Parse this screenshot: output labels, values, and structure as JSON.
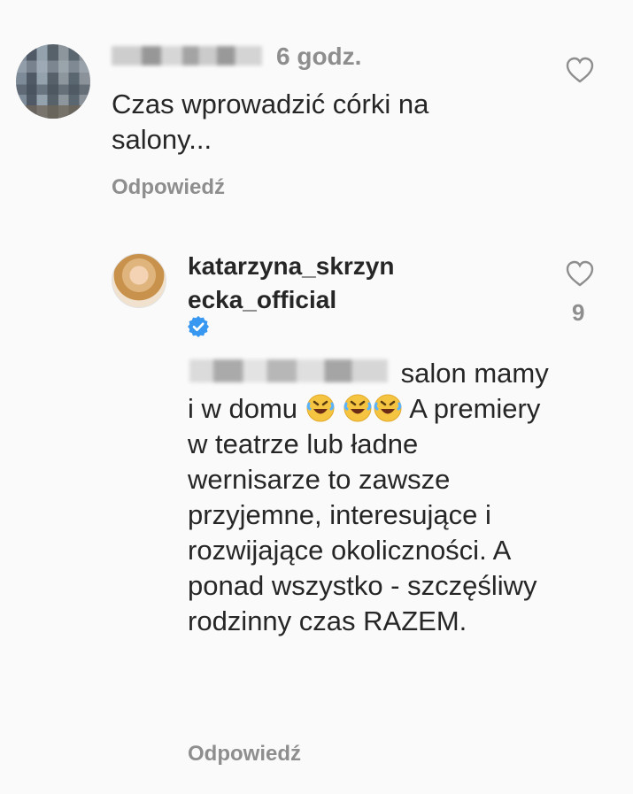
{
  "comment": {
    "time": "6 godz.",
    "text": "Czas wprowadzić córki na salony...",
    "reply_label": "Odpowiedź"
  },
  "reply": {
    "username": "katarzyna_skrzynecka_official",
    "likes": "9",
    "text_parts": [
      "salon mamy i w domu",
      "A premiery w teatrze lub ładne wernisarze to zawsze przyjemne, interesujące i rozwijające okoliczności. A ponad wszystko - szczęśliwy rodzinny czas RAZEM."
    ],
    "reply_label": "Odpowiedź"
  },
  "icons": {
    "heart": "heart-outline-icon",
    "verified": "verified-badge-icon",
    "emoji": "rolling-on-floor-laughing-emoji"
  },
  "colors": {
    "background": "#fafafa",
    "text": "#262626",
    "muted": "#8e8e8e",
    "verified_blue": "#3897f0",
    "emoji_yellow": "#f5c542"
  }
}
